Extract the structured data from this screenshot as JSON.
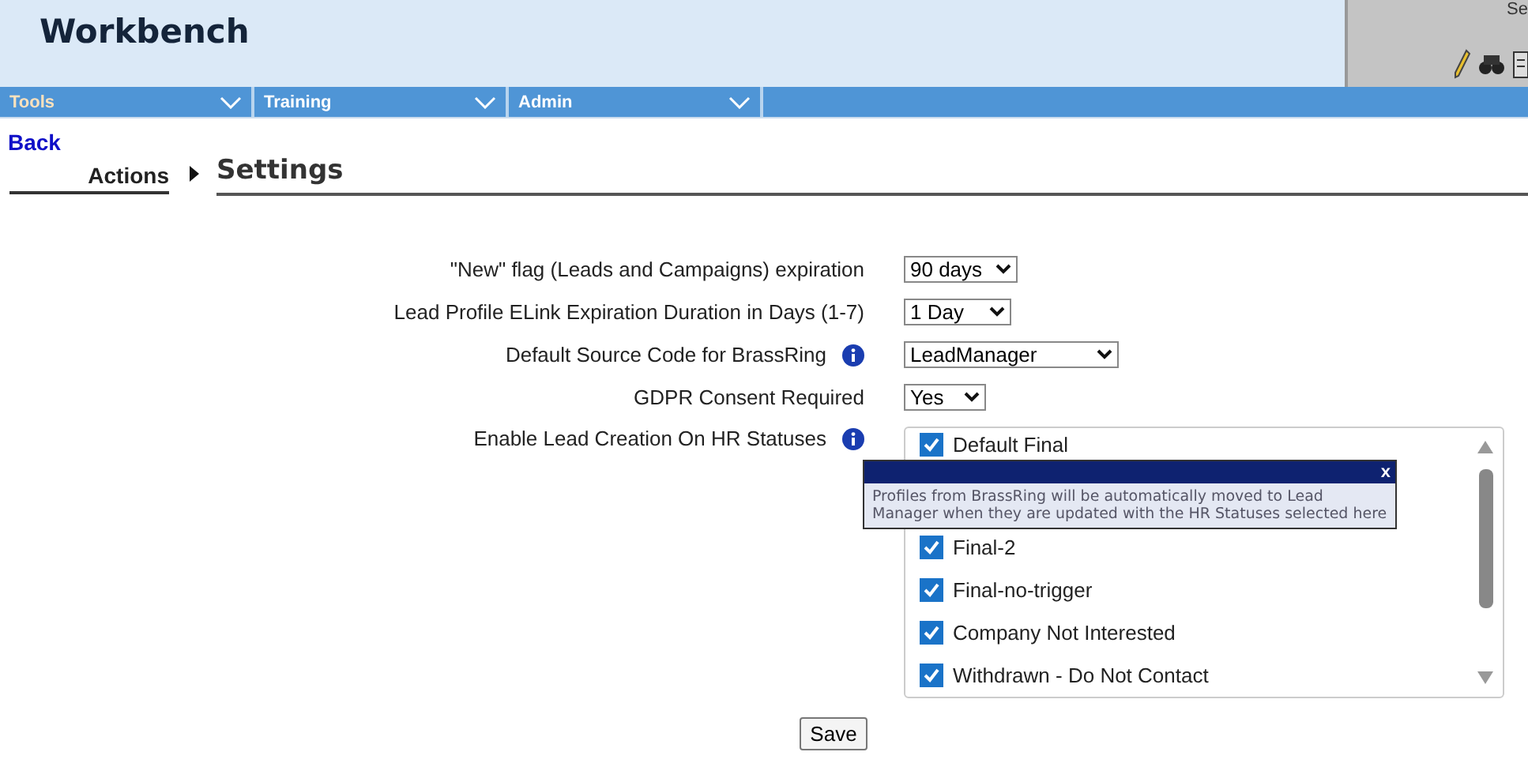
{
  "header": {
    "title": "Workbench",
    "panel_text": "Se"
  },
  "nav": [
    {
      "label": "Tools",
      "selected": true
    },
    {
      "label": "Training",
      "selected": false
    },
    {
      "label": "Admin",
      "selected": false
    }
  ],
  "back_link": "Back",
  "breadcrumb": {
    "parent": "Actions",
    "title": "Settings"
  },
  "settings": [
    {
      "label": "\"New\" flag (Leads and Campaigns) expiration",
      "kind": "select",
      "value": "90 days",
      "info": false
    },
    {
      "label": "Lead Profile ELink Expiration Duration in Days (1-7)",
      "kind": "select",
      "value": "1 Day",
      "info": false
    },
    {
      "label": "Default Source Code for BrassRing",
      "kind": "select",
      "value": "LeadManager",
      "info": true
    },
    {
      "label": "GDPR Consent Required",
      "kind": "select",
      "value": "Yes",
      "info": false
    },
    {
      "label": "Enable Lead Creation On HR Statuses",
      "kind": "checklist",
      "info": true,
      "options": [
        {
          "label": "Default Final",
          "checked": true
        },
        {
          "label": "Final-2",
          "checked": true
        },
        {
          "label": "Final-no-trigger",
          "checked": true
        },
        {
          "label": "Company Not Interested",
          "checked": true
        },
        {
          "label": "Withdrawn - Do Not Contact",
          "checked": true
        }
      ]
    }
  ],
  "tooltip": {
    "close": "x",
    "text": "Profiles from BrassRing will be automatically moved to Lead Manager when they are updated with the HR Statuses selected here"
  },
  "save_button": "Save"
}
